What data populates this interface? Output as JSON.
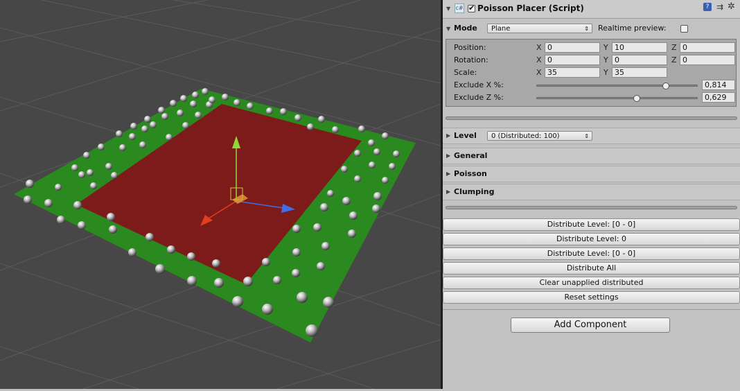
{
  "inspector": {
    "component_title": "Poisson Placer (Script)",
    "component_enabled": true,
    "mode": {
      "label": "Mode",
      "value": "Plane",
      "realtime_label": "Realtime preview:",
      "realtime_checked": false
    },
    "transform": {
      "position": {
        "label": "Position:",
        "x": "0",
        "y": "10",
        "z": "0"
      },
      "rotation": {
        "label": "Rotation:",
        "x": "0",
        "y": "0",
        "z": "0"
      },
      "scale": {
        "label": "Scale:",
        "x": "35",
        "y": "35"
      },
      "axis_x": "X",
      "axis_y": "Y",
      "axis_z": "Z"
    },
    "exclude_x": {
      "label": "Exclude X %:",
      "value": "0,814",
      "fraction": 0.814
    },
    "exclude_z": {
      "label": "Exclude Z %:",
      "value": "0,629",
      "fraction": 0.629
    },
    "level": {
      "label": "Level",
      "value": "0 (Distributed: 100)"
    },
    "sections": [
      "General",
      "Poisson",
      "Clumping"
    ],
    "buttons": [
      "Distribute Level: [0 - 0]",
      "Distribute Level: 0",
      "Distribute Level: [0 - 0]",
      "Distribute All",
      "Clear unapplied distributed",
      "Reset settings"
    ],
    "add_component": "Add Component"
  },
  "icons": {
    "foldout": "triangle-down-icon",
    "script": "cs-script-icon",
    "help": "help-icon",
    "preset": "preset-icon",
    "settings": "gear-icon"
  },
  "colors": {
    "ground_green": "#2b8a1f",
    "exclusion_red": "#7d1a1a",
    "scene_bg": "#474747",
    "gizmo_y": "#8fd83a",
    "gizmo_x": "#e0401c",
    "gizmo_z": "#3f6ee8"
  }
}
